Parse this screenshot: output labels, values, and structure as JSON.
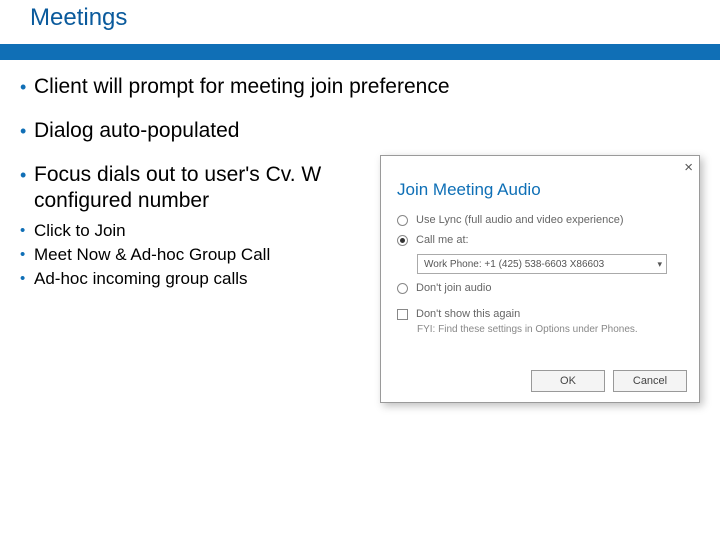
{
  "header": {
    "title": "Meetings"
  },
  "bullets": {
    "b1": "Client will prompt for meeting join preference",
    "b2": "Dialog auto-populated",
    "b3": "Focus dials out to user's Cv. W configured number",
    "s1": "Click to Join",
    "s2": "Meet Now & Ad-hoc Group Call",
    "s3": "Ad-hoc incoming group calls"
  },
  "dialog": {
    "title": "Join Meeting Audio",
    "opt1": "Use Lync (full audio and video experience)",
    "opt2": "Call me at:",
    "phone_select": "Work Phone: +1 (425) 538-6603 X86603",
    "opt3": "Don't join audio",
    "dont_show": "Don't show this again",
    "fyi": "FYI: Find these settings in Options under Phones.",
    "ok": "OK",
    "cancel": "Cancel"
  }
}
